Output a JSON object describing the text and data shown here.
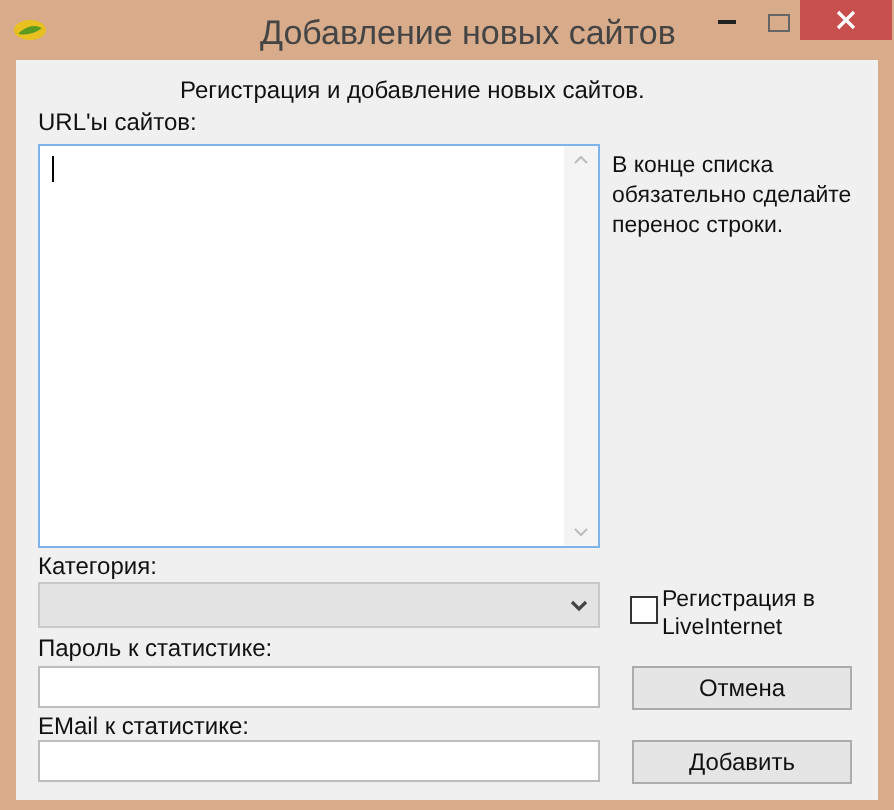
{
  "window": {
    "title": "Добавление новых сайтов"
  },
  "heading": "Регистрация и добавление новых сайтов.",
  "urls": {
    "label": "URL'ы сайтов:",
    "hint": "В конце списка обязательно сделайте перенос строки."
  },
  "category": {
    "label": "Категория:"
  },
  "liveinternet": {
    "label": "Регистрация в LiveInternet",
    "checked": false
  },
  "password": {
    "label": "Пароль к статистике:"
  },
  "email": {
    "label": "EMail к статистике:"
  },
  "buttons": [
    "Отмена",
    "Добавить"
  ]
}
